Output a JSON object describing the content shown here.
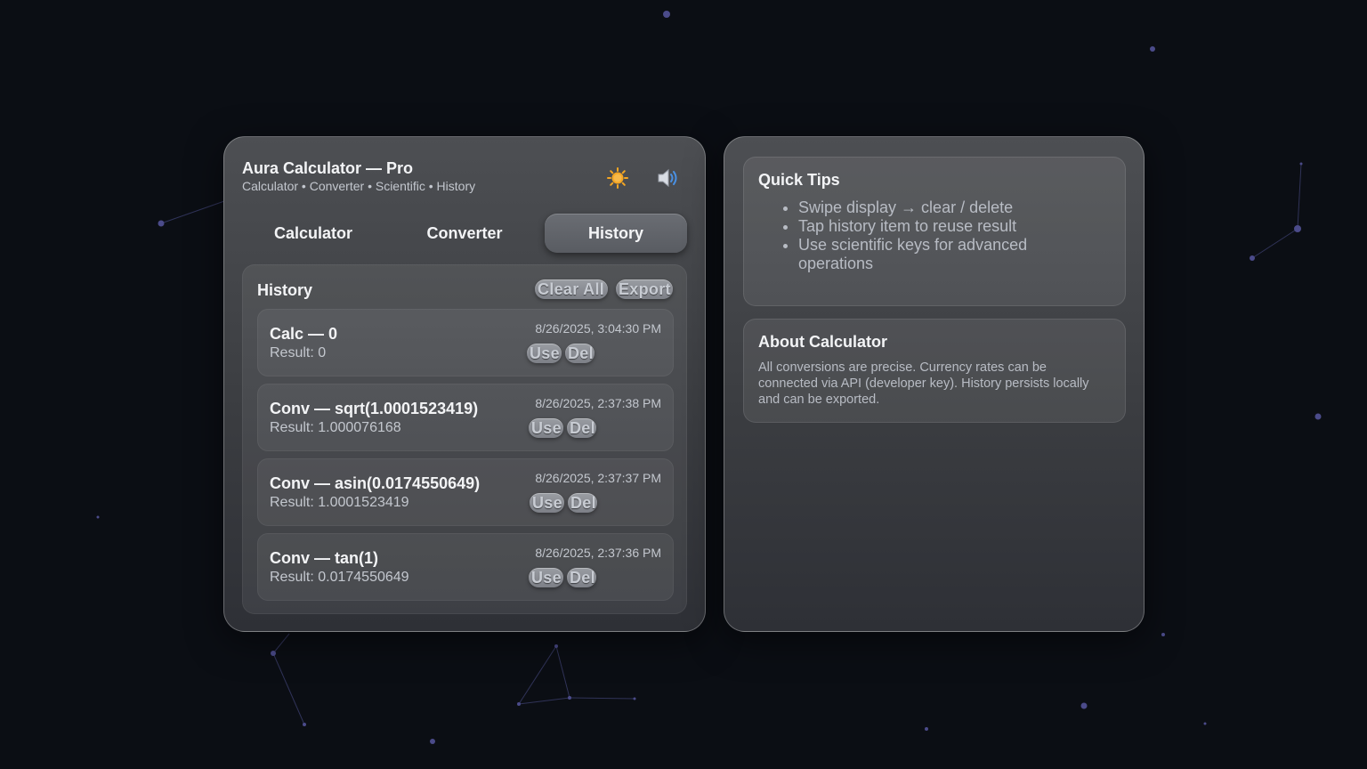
{
  "app": {
    "title": "Aura Calculator — Pro",
    "subtitle": "Calculator • Converter • Scientific • History",
    "theme_icon": "sun-icon",
    "sound_icon": "speaker-icon"
  },
  "tabs": [
    {
      "label": "Calculator",
      "active": false
    },
    {
      "label": "Converter",
      "active": false
    },
    {
      "label": "History",
      "active": true
    }
  ],
  "history": {
    "title": "History",
    "clear_all_label": "Clear All",
    "export_label": "Export",
    "entries": [
      {
        "title": "Calc — 0",
        "result": "Result: 0",
        "time": "8/26/2025, 3:04:30 PM",
        "use_label": "Use",
        "del_label": "Del"
      },
      {
        "title": "Conv — sqrt(1.0001523419)",
        "result": "Result: 1.000076168",
        "time": "8/26/2025, 2:37:38 PM",
        "use_label": "Use",
        "del_label": "Del"
      },
      {
        "title": "Conv — asin(0.0174550649)",
        "result": "Result: 1.0001523419",
        "time": "8/26/2025, 2:37:37 PM",
        "use_label": "Use",
        "del_label": "Del"
      },
      {
        "title": "Conv — tan(1)",
        "result": "Result: 0.0174550649",
        "time": "8/26/2025, 2:37:36 PM",
        "use_label": "Use",
        "del_label": "Del"
      }
    ]
  },
  "tips": {
    "title": "Quick Tips",
    "items": [
      "Swipe display → clear / delete",
      "Tap history item to reuse result",
      "Use scientific keys for advanced operations"
    ]
  },
  "about": {
    "title": "About Calculator",
    "text": "All conversions are precise. Currency rates can be connected via API (developer key). History persists locally and can be exported."
  },
  "colors": {
    "background": "#0b0e14",
    "sun": "#f5a623",
    "star": "#4b4b8a"
  }
}
